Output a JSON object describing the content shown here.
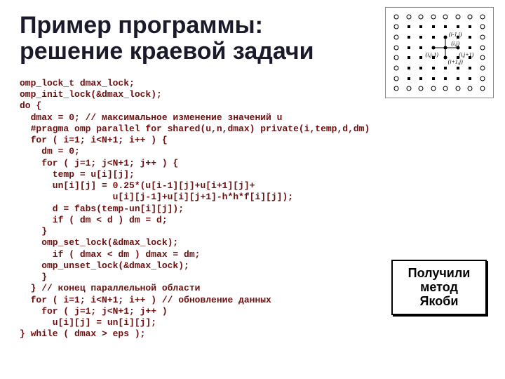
{
  "title": "Пример программы:\nрешение краевой задачи",
  "code": "omp_lock_t dmax_lock;\nomp_init_lock(&dmax_lock);\ndo {\n  dmax = 0; // максимальное изменение значений u\n  #pragma omp parallel for shared(u,n,dmax) private(i,temp,d,dm)\n  for ( i=1; i<N+1; i++ ) {\n    dm = 0;\n    for ( j=1; j<N+1; j++ ) {\n      temp = u[i][j];\n      un[i][j] = 0.25*(u[i-1][j]+u[i+1][j]+\n                 u[i][j-1]+u[i][j+1]-h*h*f[i][j]);\n      d = fabs(temp-un[i][j]);\n      if ( dm < d ) dm = d;\n    }\n    omp_set_lock(&dmax_lock);\n      if ( dmax < dm ) dmax = dm;\n    omp_unset_lock(&dmax_lock);\n    }\n  } // конец параллельной области\n  for ( i=1; i<N+1; i++ ) // обновление данных\n    for ( j=1; j<N+1; j++ )\n      u[i][j] = un[i][j];\n} while ( dmax > eps );",
  "callout": "Получили\nметод\nЯкоби",
  "diagram": {
    "labels": {
      "center": "(i,j)",
      "up": "(i-1,j)",
      "down": "(i+1,j)",
      "left": "(i,j-1)",
      "right": "(i,j+1)"
    }
  }
}
